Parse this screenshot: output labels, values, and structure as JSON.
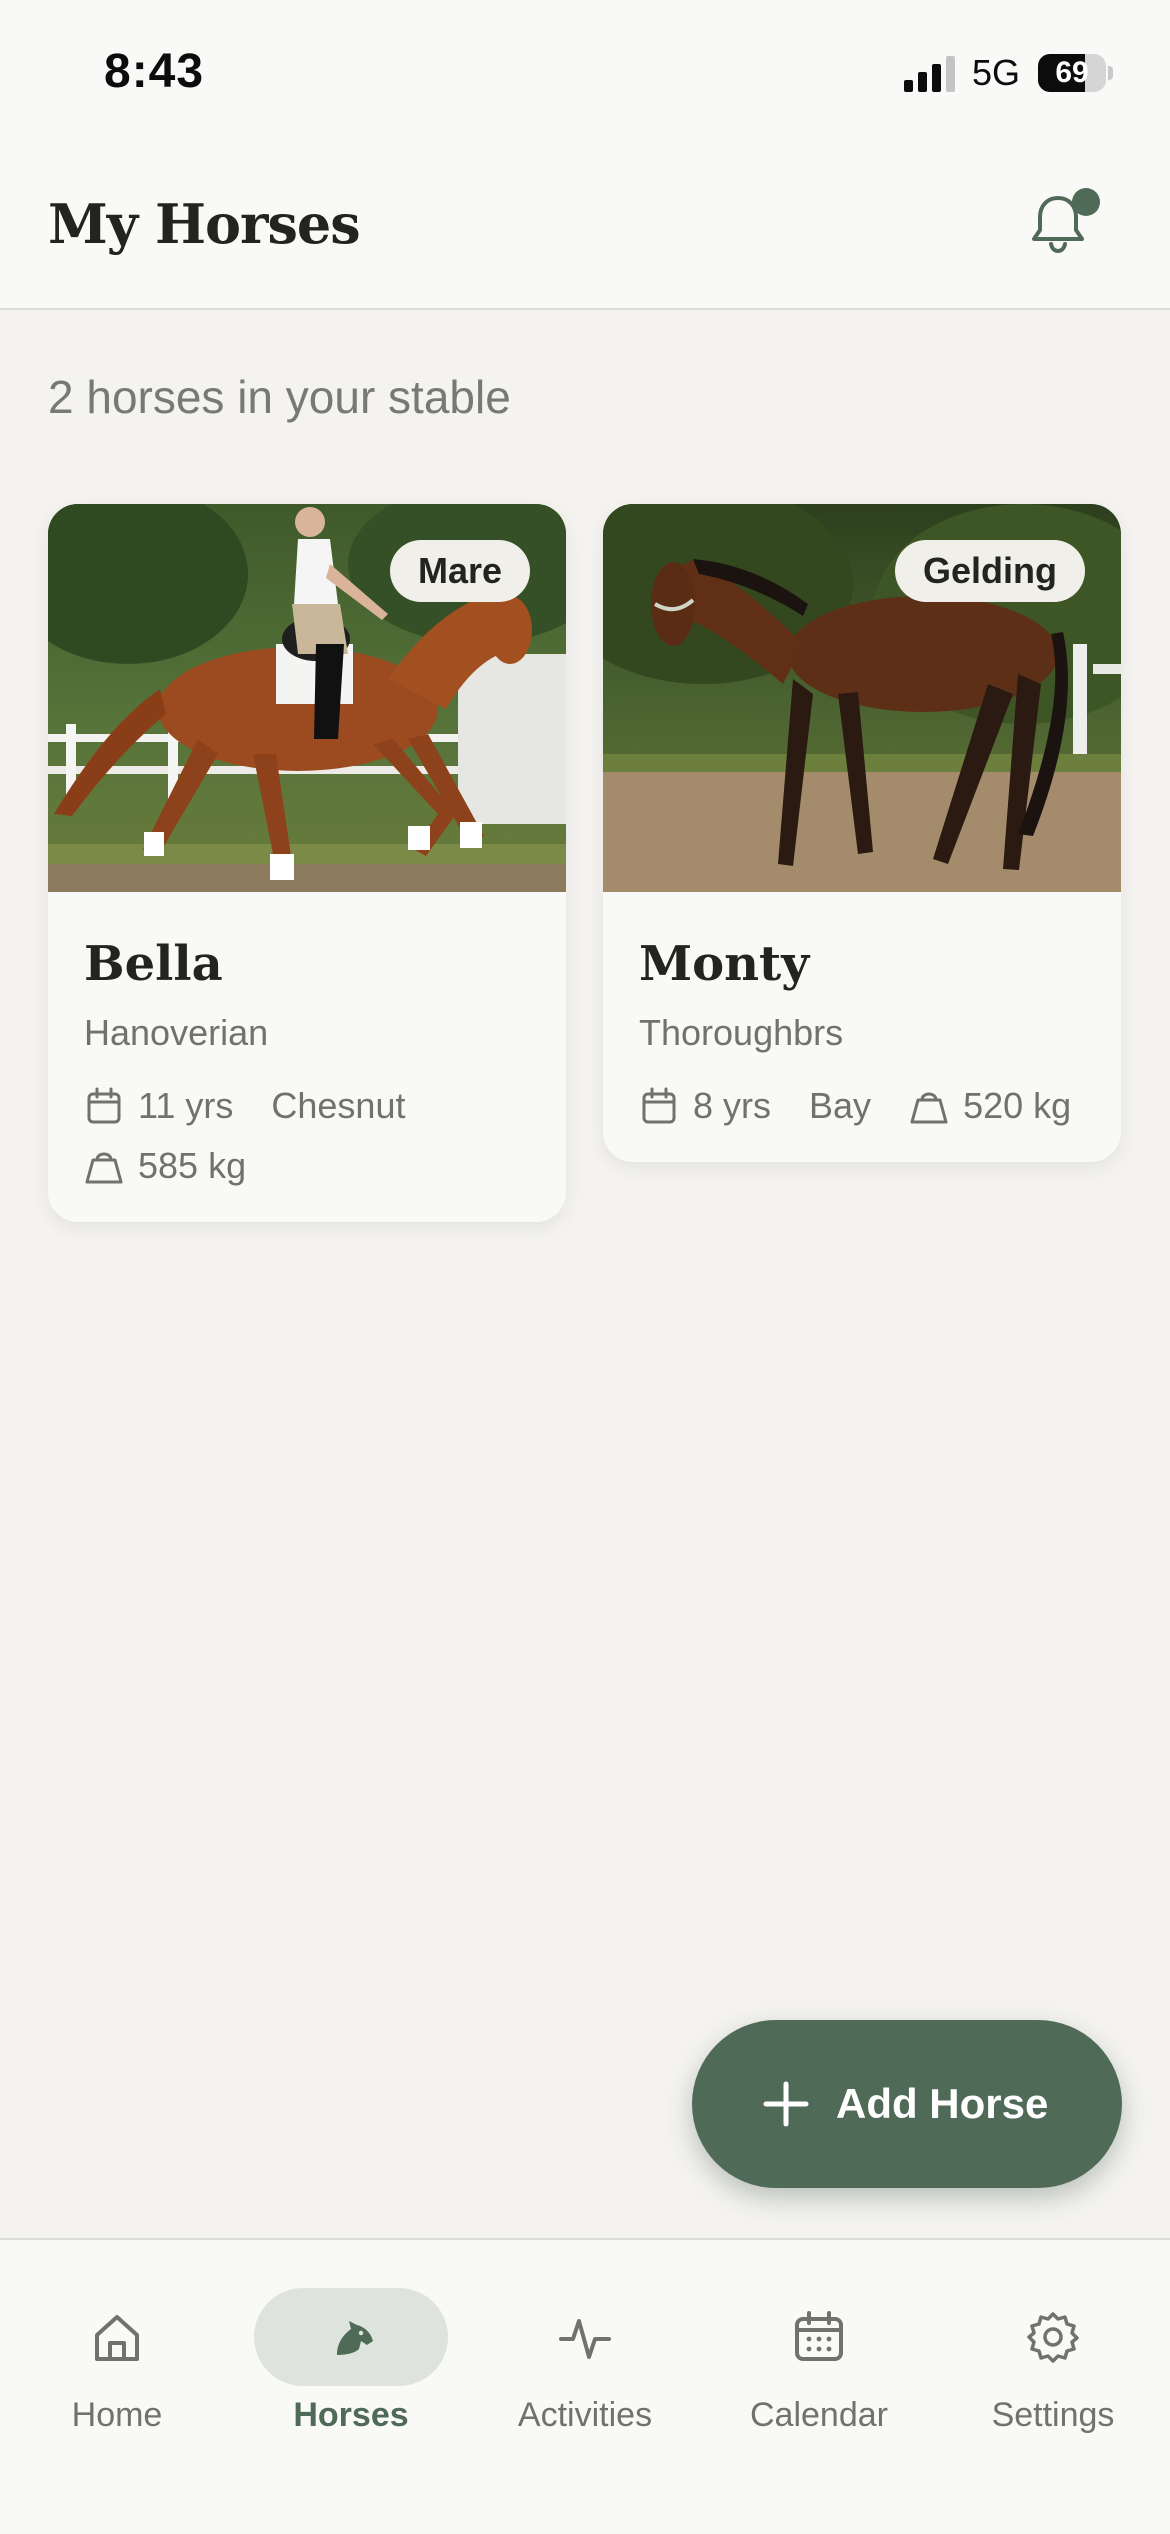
{
  "status_bar": {
    "time": "8:43",
    "network": "5G",
    "battery_percent": "69",
    "battery_level": 0.69
  },
  "header": {
    "title": "My Horses",
    "notification_icon": "bell-icon",
    "has_unread_notifications": true
  },
  "summary": {
    "stable_count_text": "2 horses in your stable"
  },
  "horses": [
    {
      "name": "Bella",
      "gender": "Mare",
      "breed": "Hanoverian",
      "age": "11 yrs",
      "color": "Chesnut",
      "weight": "585 kg",
      "photo": "chestnut horse with rider in white saddle pad trotting in an arena"
    },
    {
      "name": "Monty",
      "gender": "Gelding",
      "breed": "Thoroughbrs",
      "age": "8 yrs",
      "color": "Bay",
      "weight": "520 kg",
      "photo": "bay horse in a halter standing on a dirt paddock"
    }
  ],
  "fab": {
    "label": "Add Horse",
    "icon": "plus-icon"
  },
  "tab_bar": {
    "tabs": [
      {
        "label": "Home",
        "icon": "home-icon",
        "active": false
      },
      {
        "label": "Horses",
        "icon": "horse-head-icon",
        "active": true
      },
      {
        "label": "Activities",
        "icon": "activity-pulse-icon",
        "active": false
      },
      {
        "label": "Calendar",
        "icon": "calendar-icon",
        "active": false
      },
      {
        "label": "Settings",
        "icon": "gear-icon",
        "active": false
      }
    ]
  },
  "colors": {
    "accent": "#4f6b57",
    "background": "#f4f3f0",
    "surface": "#f9f9f7",
    "text_primary": "#23241f",
    "text_secondary": "#70736d",
    "active_tab_pill": "#dfe3dd"
  }
}
